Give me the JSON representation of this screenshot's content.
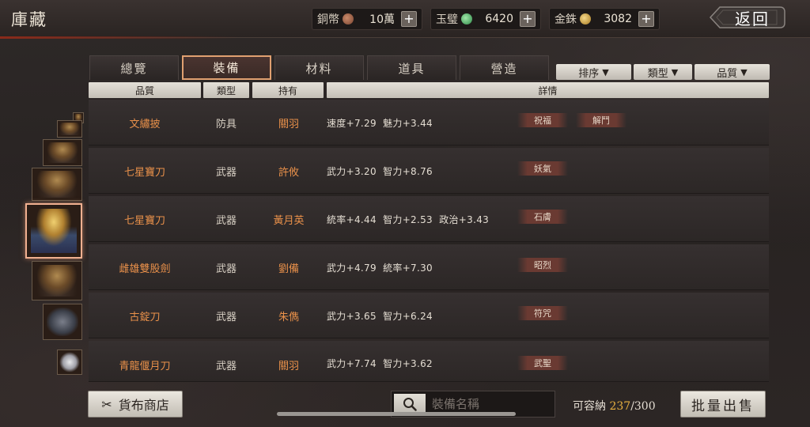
{
  "header": {
    "title": "庫藏",
    "back_label": "返回"
  },
  "currencies": [
    {
      "label": "銅幣",
      "value": "10萬",
      "coin": "copper-coin-icon",
      "color": "#b87050"
    },
    {
      "label": "玉璧",
      "value": "6420",
      "coin": "jade-coin-icon",
      "color": "#4ab060"
    },
    {
      "label": "金銖",
      "value": "3082",
      "coin": "gold-coin-icon",
      "color": "#d4a040"
    }
  ],
  "tabs": [
    "總覽",
    "裝備",
    "材料",
    "道具",
    "營造"
  ],
  "active_tab": "裝備",
  "filters": [
    "排序",
    "類型",
    "品質"
  ],
  "columns": [
    "品質",
    "類型",
    "持有",
    "詳情"
  ],
  "items": [
    {
      "name": "文繡披",
      "type": "防具",
      "owner": "關羽",
      "stats": "速度+7.29  魅力+3.44",
      "tags": [
        "祝福",
        "解鬥"
      ]
    },
    {
      "name": "七星寶刀",
      "type": "武器",
      "owner": "許攸",
      "stats": "武力+3.20  智力+8.76",
      "tags": [
        "妖氣"
      ]
    },
    {
      "name": "七星寶刀",
      "type": "武器",
      "owner": "黃月英",
      "stats": "統率+4.44  智力+2.53  政治+3.43",
      "tags": [
        "石膚"
      ]
    },
    {
      "name": "雌雄雙股劍",
      "type": "武器",
      "owner": "劉備",
      "stats": "武力+4.79  統率+7.30",
      "tags": [
        "昭烈"
      ]
    },
    {
      "name": "古錠刀",
      "type": "武器",
      "owner": "朱儁",
      "stats": "武力+3.65  智力+6.24",
      "tags": [
        "符咒"
      ]
    },
    {
      "name": "青龍偃月刀",
      "type": "武器",
      "owner": "關羽",
      "stats": "武力+7.74  智力+3.62",
      "tags": [
        "武聖"
      ]
    }
  ],
  "footer": {
    "shop_label": "貨布商店",
    "search_placeholder": "裝備名稱",
    "capacity_label": "可容納",
    "capacity_current": "237",
    "capacity_max": "/300",
    "sell_label": "批量出售"
  }
}
